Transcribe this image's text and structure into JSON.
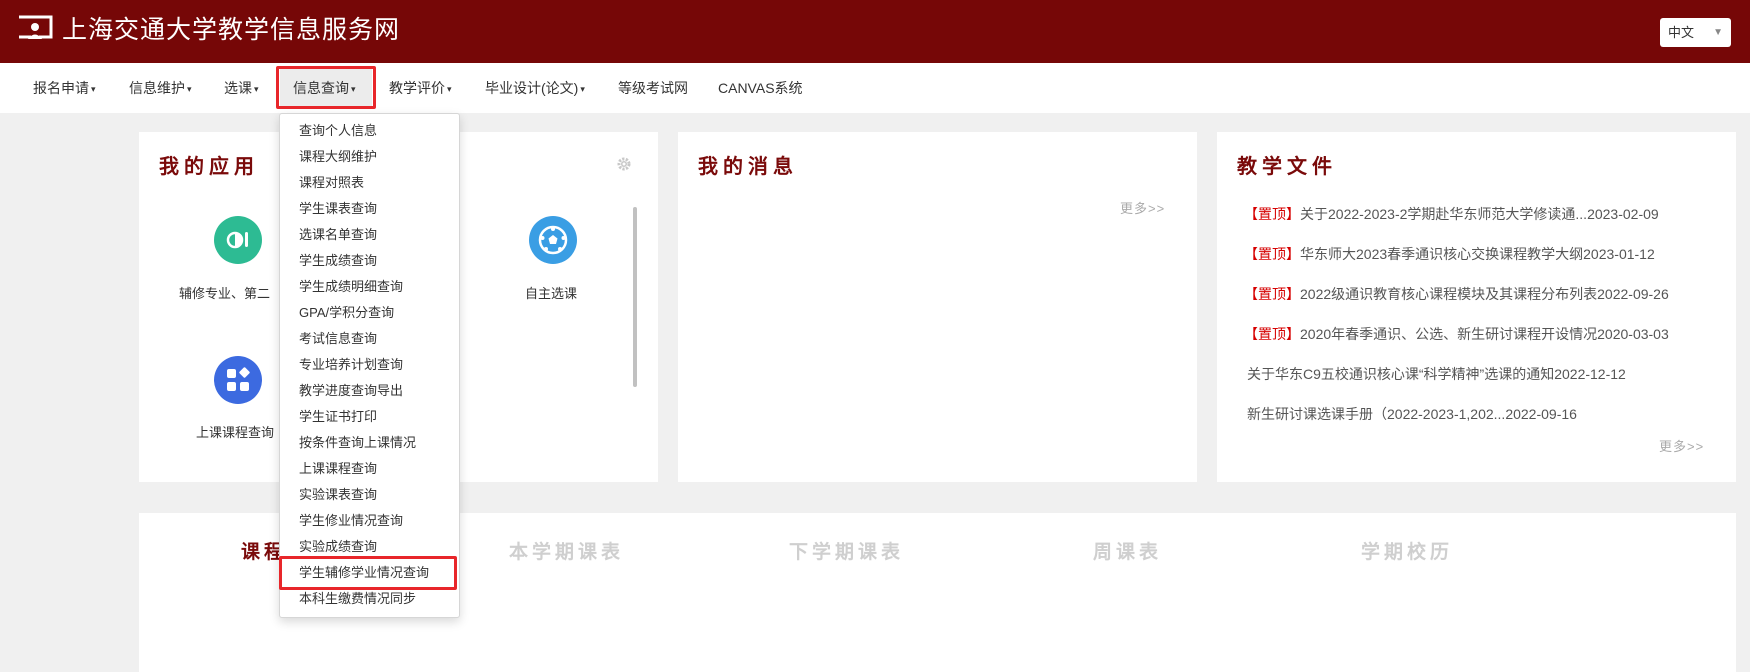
{
  "header": {
    "site_title": "上海交通大学教学信息服务网",
    "language": "中文",
    "background_color": "#760707"
  },
  "nav": {
    "items": [
      {
        "label": "报名申请",
        "has_dropdown": true
      },
      {
        "label": "信息维护",
        "has_dropdown": true
      },
      {
        "label": "选课",
        "has_dropdown": true
      },
      {
        "label": "信息查询",
        "has_dropdown": true,
        "active": true
      },
      {
        "label": "教学评价",
        "has_dropdown": true
      },
      {
        "label": "毕业设计(论文)",
        "has_dropdown": true
      },
      {
        "label": "等级考试网",
        "has_dropdown": false
      },
      {
        "label": "CANVAS系统",
        "has_dropdown": false
      }
    ]
  },
  "dropdown": {
    "items": [
      "查询个人信息",
      "课程大纲维护",
      "课程对照表",
      "学生课表查询",
      "选课名单查询",
      "学生成绩查询",
      "学生成绩明细查询",
      "GPA/学积分查询",
      "考试信息查询",
      "专业培养计划查询",
      "教学进度查询导出",
      "学生证书打印",
      "按条件查询上课情况",
      "上课课程查询",
      "实验课表查询",
      "学生修业情况查询",
      "实验成绩查询",
      "学生辅修学业情况查询",
      "本科生缴费情况同步"
    ],
    "highlighted": "学生辅修学业情况查询"
  },
  "apps": {
    "title": "我的应用",
    "items": [
      {
        "label": "辅修专业、第二",
        "icon": "pie-chart-icon",
        "color": "#2dbb93"
      },
      {
        "label": "自主选课",
        "icon": "soccer-ball-icon",
        "color": "#3a9ee4"
      },
      {
        "label": "上课课程查询",
        "icon": "apps-grid-icon",
        "color": "#3c6ae0"
      }
    ]
  },
  "messages": {
    "title": "我的消息",
    "more": "更多>>"
  },
  "docs": {
    "title": "教学文件",
    "more": "更多>>",
    "items": [
      {
        "tag": "【置顶】",
        "text": "关于2022-2023-2学期赴华东师范大学修读通...2023-02-09"
      },
      {
        "tag": "【置顶】",
        "text": "华东师大2023春季通识核心交换课程教学大纲2023-01-12"
      },
      {
        "tag": "【置顶】",
        "text": "2022级通识教育核心课程模块及其课程分布列表2022-09-26"
      },
      {
        "tag": "【置顶】",
        "text": "2020年春季通识、公选、新生研讨课程开设情况2020-03-03"
      },
      {
        "tag": "",
        "text": "关于华东C9五校通识核心课“科学精神”选课的通知2022-12-12"
      },
      {
        "tag": "",
        "text": "新生研讨课选课手册（2022-2023-1,202...2022-09-16"
      }
    ]
  },
  "schedule_tabs": {
    "items": [
      "课程",
      "本学期课表",
      "下学期课表",
      "周课表",
      "学期校历"
    ]
  }
}
